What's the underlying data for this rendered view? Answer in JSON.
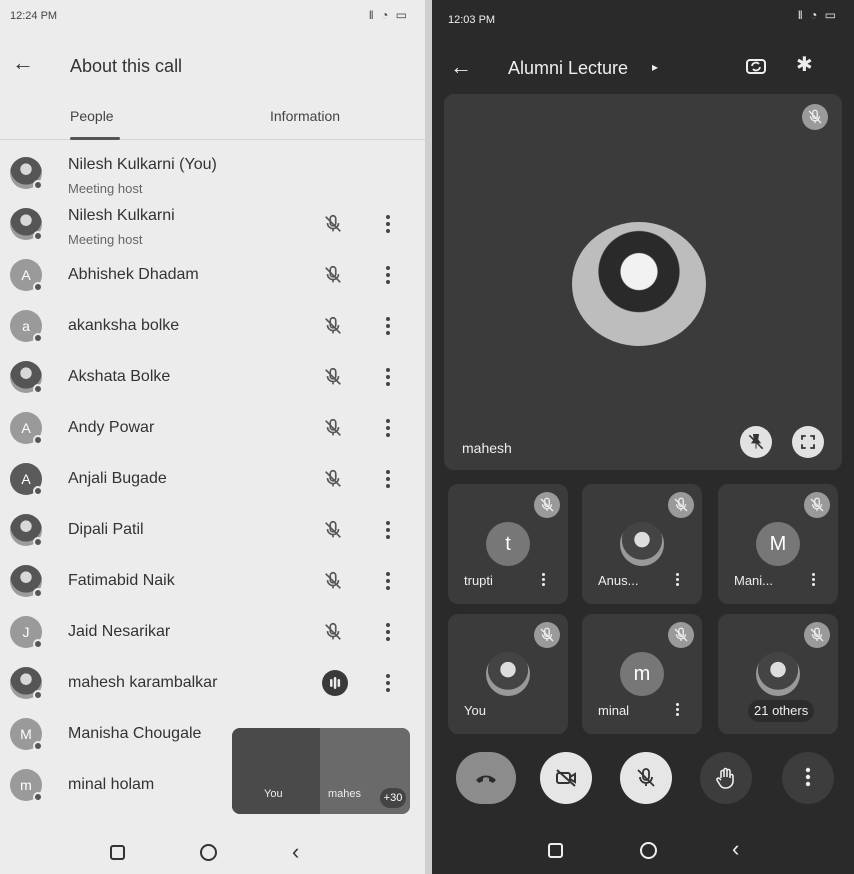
{
  "left_phone": {
    "status_time": "12:24 PM",
    "status_icons": "‖ ◔ ▭",
    "back_glyph": "←",
    "title": "About this call",
    "tabs": [
      {
        "label": "People",
        "active": true
      },
      {
        "label": "Information",
        "active": false
      }
    ],
    "participants": [
      {
        "name": "Nilesh Kulkarni (You)",
        "sub": "Meeting host",
        "avatar": "",
        "state": "none"
      },
      {
        "name": "Nilesh Kulkarni",
        "sub": "Meeting host",
        "avatar": "",
        "state": "muted"
      },
      {
        "name": "Abhishek Dhadam",
        "sub": "",
        "avatar": "A",
        "state": "muted"
      },
      {
        "name": "akanksha bolke",
        "sub": "",
        "avatar": "a",
        "state": "muted"
      },
      {
        "name": "Akshata Bolke",
        "sub": "",
        "avatar": "",
        "state": "muted"
      },
      {
        "name": "Andy Powar",
        "sub": "",
        "avatar": "A",
        "state": "muted"
      },
      {
        "name": "Anjali Bugade",
        "sub": "",
        "avatar": "A",
        "state": "muted"
      },
      {
        "name": "Dipali Patil",
        "sub": "",
        "avatar": "",
        "state": "muted"
      },
      {
        "name": "Fatimabid Naik",
        "sub": "",
        "avatar": "",
        "state": "muted"
      },
      {
        "name": "Jaid Nesarikar",
        "sub": "",
        "avatar": "J",
        "state": "muted"
      },
      {
        "name": "mahesh karambalkar",
        "sub": "",
        "avatar": "",
        "state": "speaking"
      },
      {
        "name": "Manisha Chougale",
        "sub": "",
        "avatar": "M",
        "state": "none"
      },
      {
        "name": "minal holam",
        "sub": "",
        "avatar": "m",
        "state": "none"
      }
    ],
    "mini_call": {
      "you_label": "You",
      "other_label": "mahes",
      "badge": "+30"
    },
    "nav_back": "‹"
  },
  "right_phone": {
    "status_time": "12:03 PM",
    "status_icons": "‖ ◔ ▭",
    "back_glyph": "←",
    "title": "Alumni Lecture",
    "title_caret": "▸",
    "bluetooth_glyph": "✱",
    "main_tile_name": "mahesh",
    "tiles": [
      {
        "name": "trupti",
        "avatar": "t",
        "photo": false,
        "others": ""
      },
      {
        "name": "Anus...",
        "avatar": "",
        "photo": true,
        "others": ""
      },
      {
        "name": "Mani...",
        "avatar": "M",
        "photo": false,
        "others": ""
      },
      {
        "name": "You",
        "avatar": "",
        "photo": true,
        "others": ""
      },
      {
        "name": "minal",
        "avatar": "m",
        "photo": false,
        "others": ""
      },
      {
        "name": "",
        "avatar": "",
        "photo": true,
        "others": "21 others"
      }
    ],
    "nav_back": "‹"
  }
}
